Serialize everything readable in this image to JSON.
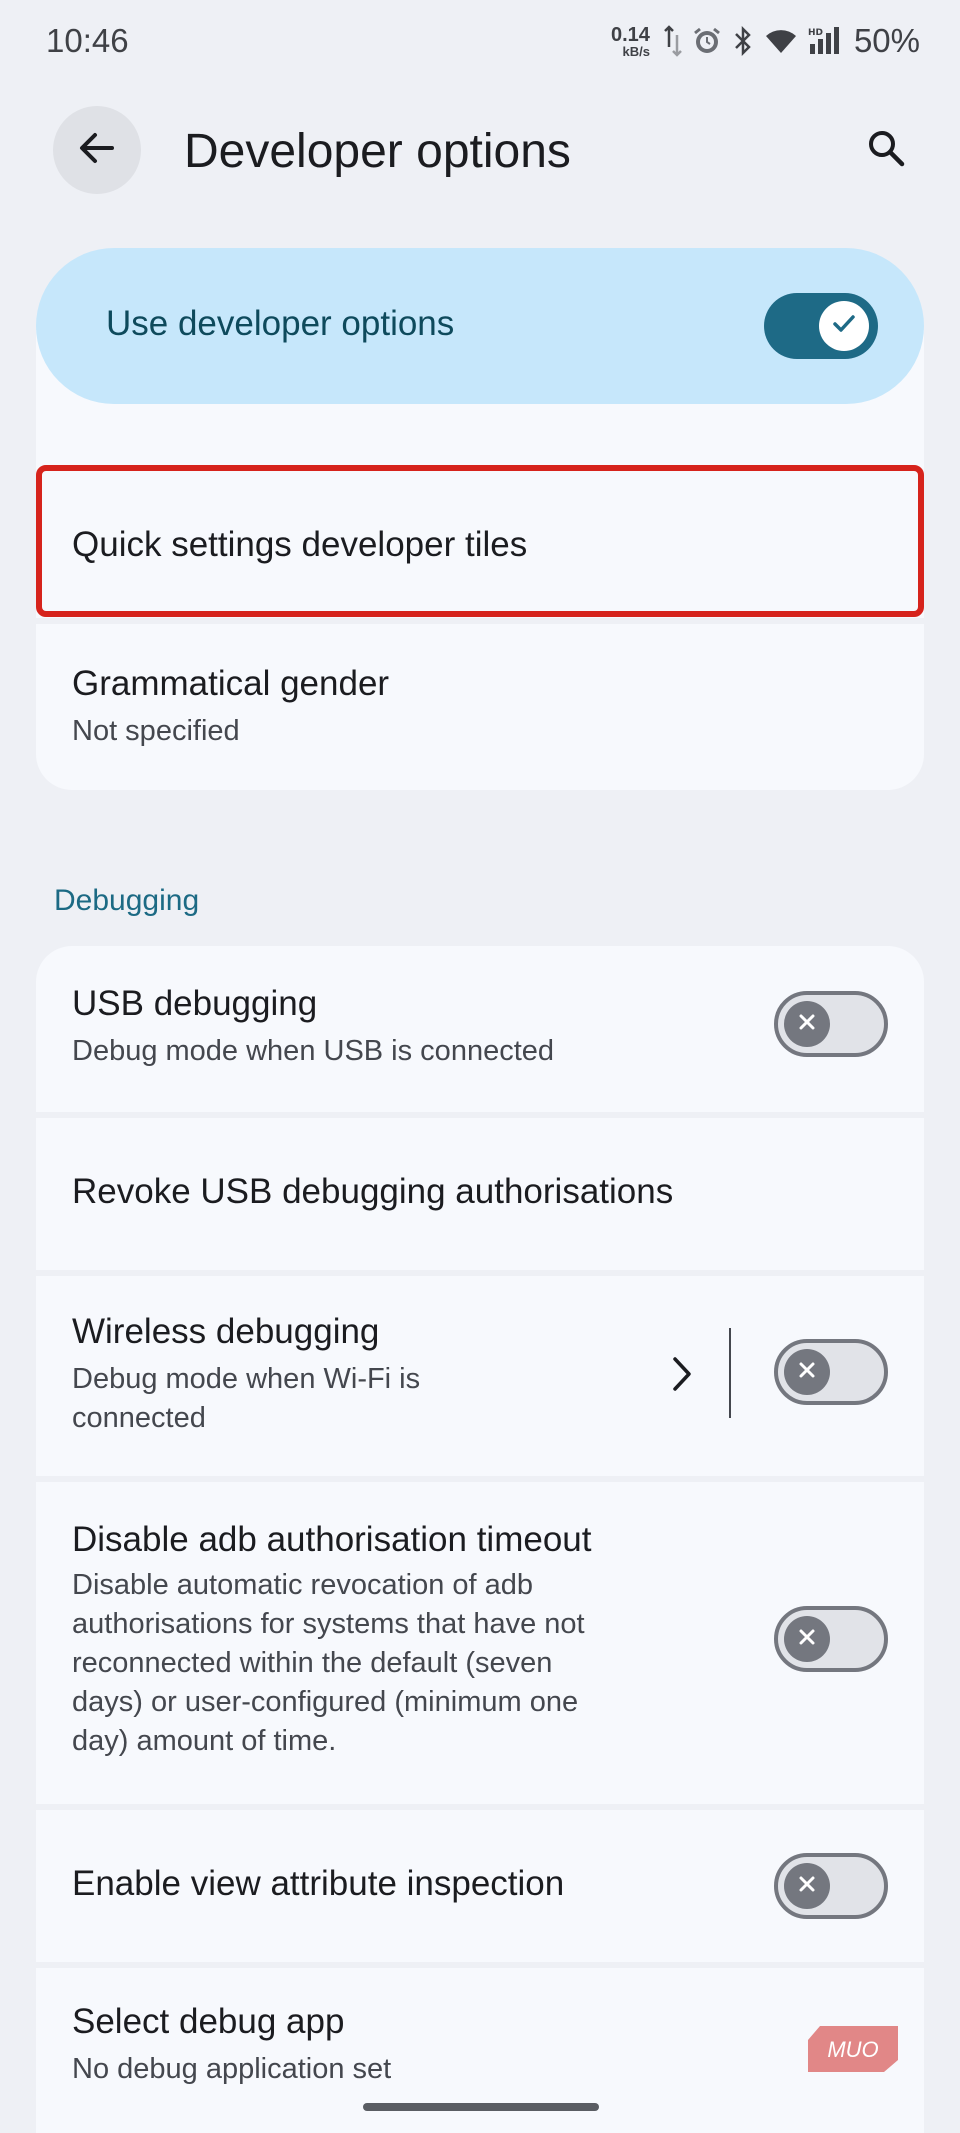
{
  "status_bar": {
    "time": "10:46",
    "net_speed_value": "0.14",
    "net_speed_unit": "kB/s",
    "battery_percent": "50%"
  },
  "app_bar": {
    "title": "Developer options"
  },
  "master_switch": {
    "label": "Use developer options",
    "checked": true
  },
  "top_items": [
    {
      "title": "Quick settings developer tiles",
      "highlighted": true
    },
    {
      "title": "Grammatical gender",
      "subtitle": "Not specified"
    }
  ],
  "debugging": {
    "section_title": "Debugging",
    "items": [
      {
        "title": "USB debugging",
        "subtitle": "Debug mode when USB is connected",
        "toggle": false
      },
      {
        "title": "Revoke USB debugging authorisations"
      },
      {
        "title": "Wireless debugging",
        "subtitle_line1": "Debug mode when Wi-Fi is",
        "subtitle_line2": "connected",
        "toggle": false,
        "has_chevron": true
      },
      {
        "title": "Disable adb authorisation timeout",
        "subtitle_lines": [
          "Disable automatic revocation of adb",
          "authorisations for systems that have not",
          "reconnected within the default (seven",
          "days) or user-configured (minimum one",
          "day) amount of time."
        ],
        "toggle": false
      },
      {
        "title": "Enable view attribute inspection",
        "toggle": false
      },
      {
        "title": "Select debug app",
        "subtitle": "No debug application set"
      }
    ]
  },
  "watermark": "MUO",
  "colors": {
    "background": "#eef0f5",
    "card": "#f7f9fd",
    "master_switch_bg": "#c6e7fb",
    "accent": "#1e6a86",
    "highlight_border": "#d6231c",
    "section_header": "#1c6a84"
  }
}
